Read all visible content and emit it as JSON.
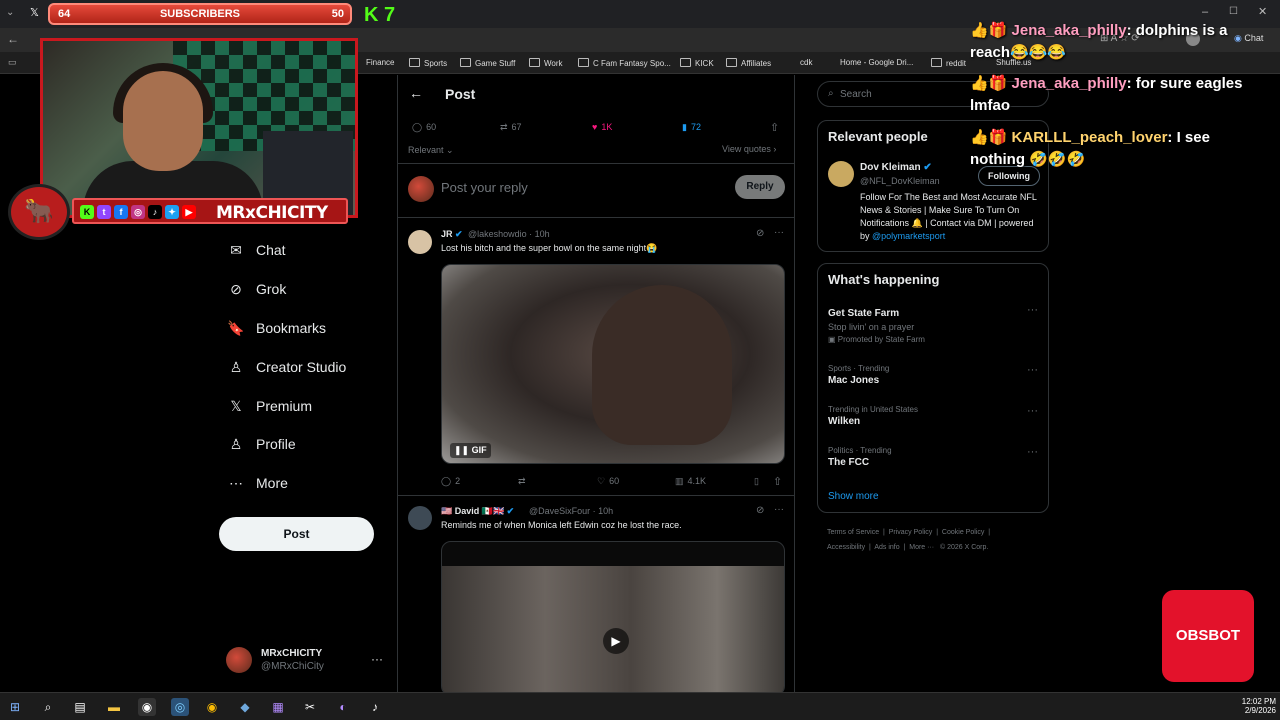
{
  "stream": {
    "sub_left": "64",
    "sub_label": "SUBSCRIBERS",
    "sub_right": "50",
    "kick_count": "7",
    "social_name": "MRxCHICITY",
    "obsbot": "OBSBOT"
  },
  "bookmarks": [
    "Finance",
    "Sports",
    "Game Stuff",
    "Work",
    "C Fam Fantasy Spo...",
    "KICK",
    "Affiliates",
    "cdk",
    "Home - Google Dri...",
    "reddit",
    "Shuffle.us"
  ],
  "browser": {
    "chat_button": "Chat"
  },
  "nav": {
    "items": [
      {
        "label": "Chat",
        "icon": "✉"
      },
      {
        "label": "Grok",
        "icon": "⊘"
      },
      {
        "label": "Bookmarks",
        "icon": "🔖"
      },
      {
        "label": "Creator Studio",
        "icon": "♙"
      },
      {
        "label": "Premium",
        "icon": "𝕏"
      },
      {
        "label": "Profile",
        "icon": "♙"
      },
      {
        "label": "More",
        "icon": "⋯"
      }
    ],
    "post_button": "Post",
    "account_name": "MRxCHICITY",
    "account_handle": "@MRxChiCity"
  },
  "post": {
    "header_title": "Post",
    "stats": {
      "replies": "60",
      "reposts": "67",
      "likes": "1K",
      "bookmarks": "72"
    },
    "sort": "Relevant",
    "view_quotes": "View quotes",
    "reply_placeholder": "Post your reply",
    "reply_button": "Reply"
  },
  "replies": [
    {
      "name": "JR",
      "handle": "@lakeshowdio · 10h",
      "text": "Lost his bitch and the super bowl on the same night",
      "media_label": "GIF",
      "stats": {
        "replies": "2",
        "likes": "60",
        "views": "4.1K"
      }
    },
    {
      "name": "David",
      "handle": "@DaveSixFour · 10h",
      "text": "Reminds me of when Monica left Edwin coz he lost the race."
    }
  ],
  "sidebar": {
    "search_placeholder": "Search",
    "relevant_title": "Relevant people",
    "person": {
      "name": "Dov Kleiman",
      "handle": "@NFL_DovKleiman",
      "follow": "Following",
      "bio": "Follow For The Best and Most Accurate NFL News & Stories | Make Sure To Turn On Notifications 🔔 | Contact via DM | powered by",
      "bio_link": "@polymarketsport"
    },
    "happening_title": "What's happening",
    "promo": {
      "title": "Get State Farm",
      "sub": "Stop livin' on a prayer",
      "promoted": "Promoted by State Farm"
    },
    "trends": [
      {
        "context": "Sports · Trending",
        "title": "Mac Jones"
      },
      {
        "context": "Trending in United States",
        "title": "Wilken"
      },
      {
        "context": "Politics · Trending",
        "title": "The FCC"
      }
    ],
    "show_more": "Show more",
    "footer_row1": [
      "Terms of Service",
      "Privacy Policy",
      "Cookie Policy"
    ],
    "footer_row2": [
      "Accessibility",
      "Ads info",
      "More ···",
      "© 2026 X Corp."
    ]
  },
  "chat": [
    {
      "user": "Jena_aka_philly",
      "msg": ": dolphins is a reach😂😂😂"
    },
    {
      "user": "Jena_aka_philly",
      "msg": ": for sure eagles lmfao"
    },
    {
      "user": "KARLLL_peach_lover",
      "msg": ": I see nothing 🤣🤣🤣"
    }
  ],
  "taskbar": {
    "time": "12:02 PM",
    "date": "2/9/2026"
  }
}
